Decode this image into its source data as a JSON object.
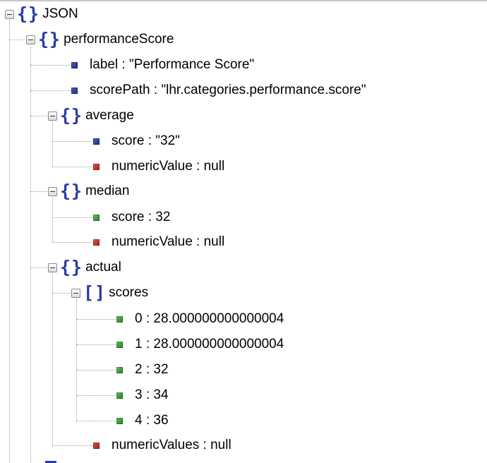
{
  "root": {
    "label": "JSON",
    "icon": "object-braces-icon"
  },
  "performanceScore": {
    "label": "performanceScore",
    "icon": "object-braces-icon",
    "fields": {
      "label": "label : \"Performance Score\"",
      "scorePath": "scorePath : \"lhr.categories.performance.score\""
    },
    "average": {
      "label": "average",
      "score": "score : \"32\"",
      "numericValue": "numericValue : null"
    },
    "median": {
      "label": "median",
      "score": "score : 32",
      "numericValue": "numericValue : null"
    },
    "actual": {
      "label": "actual",
      "scores": {
        "label": "scores",
        "icon": "array-brackets-icon",
        "items": [
          "0 : 28.000000000000004",
          "1 : 28.000000000000004",
          "2 : 32",
          "3 : 34",
          "4 : 36"
        ]
      },
      "numericValues": "numericValues : null"
    }
  },
  "icon_colors": {
    "object_braces": "#2a3aa8",
    "string_leaf": "#1b2a78",
    "number_leaf": "#2c7a2a",
    "null_leaf": "#a51e1e"
  }
}
